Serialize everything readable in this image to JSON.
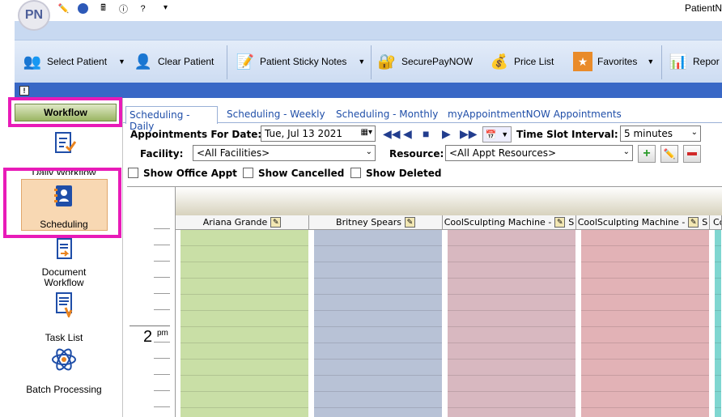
{
  "app": {
    "logo": "PN",
    "title": "PatientN"
  },
  "quick_access": [
    {
      "icon": "pencil-icon"
    },
    {
      "icon": "circle-icon"
    },
    {
      "icon": "calculator-icon"
    },
    {
      "icon": "info-icon"
    },
    {
      "icon": "help-icon"
    }
  ],
  "toolbar": {
    "select_patient": "Select Patient",
    "clear_patient": "Clear Patient",
    "sticky_notes": "Patient Sticky Notes",
    "securepay": "SecurePayNOW",
    "price_list": "Price List",
    "favorites": "Favorites",
    "reports": "Repor"
  },
  "sidebar": {
    "header": "Workflow",
    "items": [
      {
        "label": "Daily Workflow",
        "icon": "clipboard-check-icon"
      },
      {
        "label": "Scheduling",
        "icon": "address-book-icon",
        "selected": true
      },
      {
        "label": "Document\nWorkflow",
        "icon": "document-icon"
      },
      {
        "label": "Task List",
        "icon": "task-list-icon"
      },
      {
        "label": "Batch Processing",
        "icon": "atom-icon"
      }
    ]
  },
  "tabs": [
    "Scheduling - Daily",
    "Scheduling - Weekly",
    "Scheduling - Monthly",
    "myAppointmentNOW Appointments"
  ],
  "active_tab": "Scheduling - Daily",
  "form": {
    "appt_date_label": "Appointments For Date:",
    "appt_date_value": "Tue,  Jul  13 2021",
    "slot_label": "Time Slot Interval:",
    "slot_value": "5 minutes",
    "facility_label": "Facility:",
    "facility_value": "<All Facilities>",
    "resource_label": "Resource:",
    "resource_value": "<All Appt Resources>",
    "show_office": "Show Office Appt",
    "show_cancelled": "Show Cancelled",
    "show_deleted": "Show Deleted"
  },
  "schedule": {
    "hour": "2",
    "ampm": "pm",
    "columns": [
      {
        "name": "Ariana Grande",
        "color": "#c9dfa6"
      },
      {
        "name": "Britney Spears",
        "color": "#b8c2d6"
      },
      {
        "name": "CoolSculpting Machine -",
        "suffix": "S",
        "color": "#d8b8c0"
      },
      {
        "name": "CoolSculpting Machine -",
        "suffix": "S",
        "color": "#e2b2b6"
      },
      {
        "name": "Co",
        "color": "#7fd6d0"
      }
    ]
  }
}
